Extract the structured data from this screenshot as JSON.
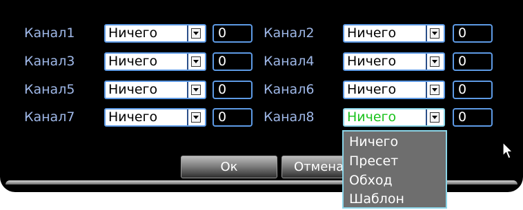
{
  "channels": [
    {
      "label": "Канал1",
      "mode": "Ничего",
      "value": "0"
    },
    {
      "label": "Канал2",
      "mode": "Ничего",
      "value": "0"
    },
    {
      "label": "Канал3",
      "mode": "Ничего",
      "value": "0"
    },
    {
      "label": "Канал4",
      "mode": "Ничего",
      "value": "0"
    },
    {
      "label": "Канал5",
      "mode": "Ничего",
      "value": "0"
    },
    {
      "label": "Канал6",
      "mode": "Ничего",
      "value": "0"
    },
    {
      "label": "Канал7",
      "mode": "Ничего",
      "value": "0"
    },
    {
      "label": "Канал8",
      "mode": "Ничего",
      "value": "0"
    }
  ],
  "dropdown": {
    "options": [
      "Ничего",
      "Пресет",
      "Обход",
      "Шаблон"
    ]
  },
  "buttons": {
    "ok": "Ок",
    "cancel": "Отмена"
  },
  "colors": {
    "label": "#9fb8e8",
    "field_border": "#5e9be6",
    "active_text": "#19c21c",
    "active_border": "#8bd5e8"
  }
}
